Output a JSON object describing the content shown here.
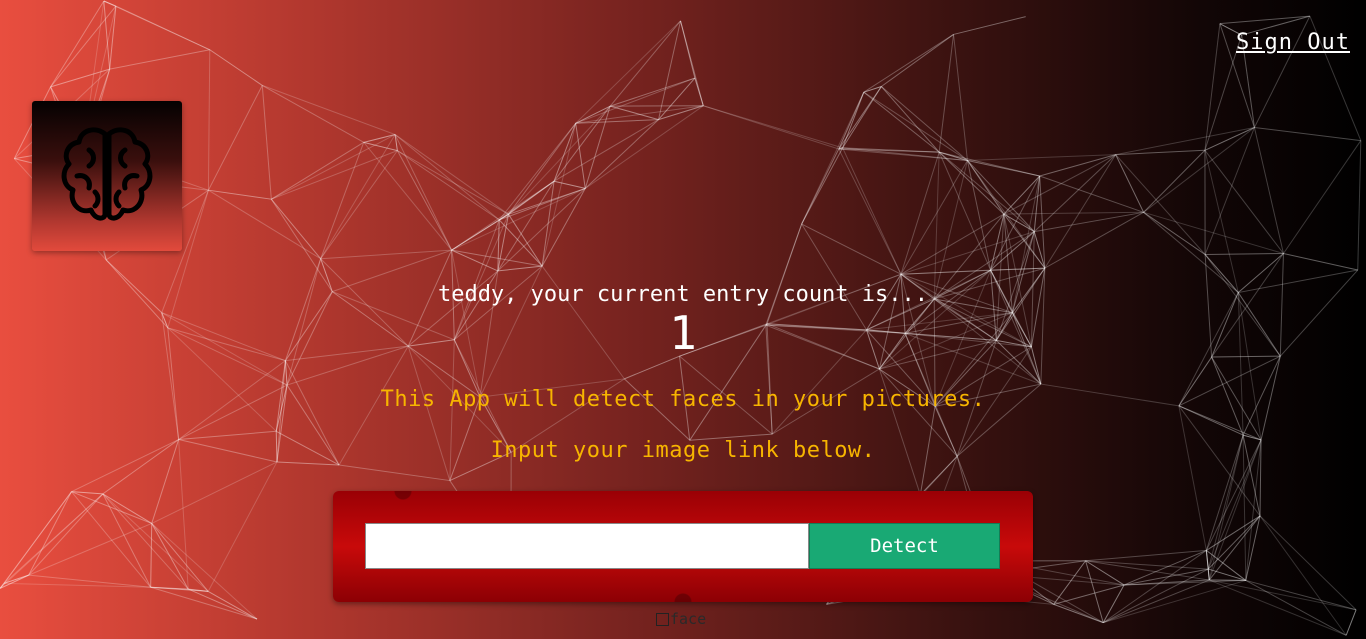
{
  "header": {
    "signout_label": "Sign Out"
  },
  "logo": {
    "icon": "brain-icon"
  },
  "rank": {
    "greeting": "teddy, your current entry count is...",
    "count": "1"
  },
  "description": {
    "line1": "This App will detect faces in your pictures.",
    "line2": "Input your image link below."
  },
  "form": {
    "input_value": "",
    "input_placeholder": "",
    "detect_label": "Detect"
  },
  "face_box": {
    "label": "face"
  },
  "colors": {
    "accent_text": "#f7b500",
    "detect_button": "#19a974",
    "panel_red": "#c80a0a"
  }
}
